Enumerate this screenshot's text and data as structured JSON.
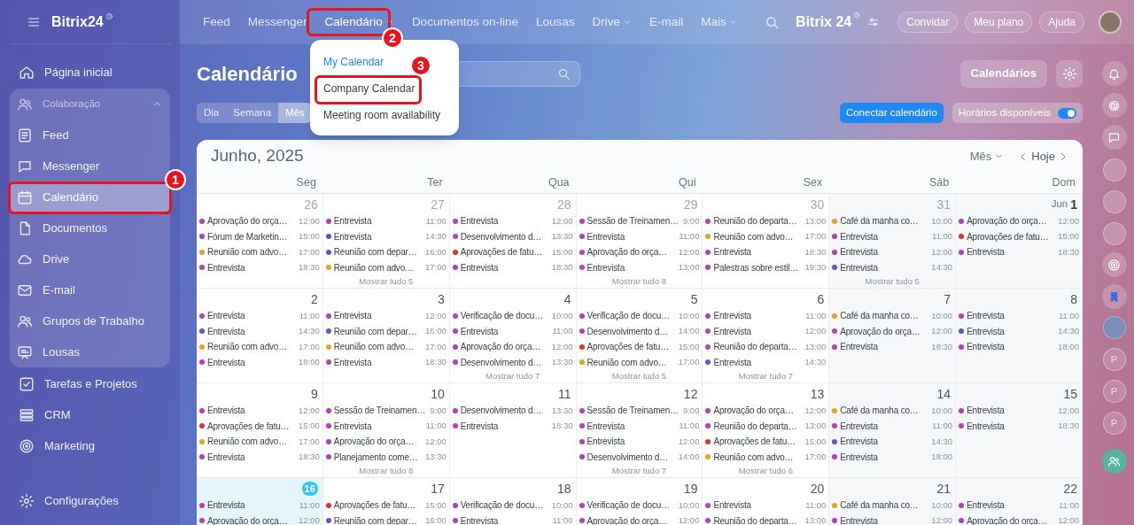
{
  "sidebar": {
    "logo": "Bitrix24",
    "items": [
      {
        "kind": "link",
        "label": "Página inicial",
        "selected": false
      },
      {
        "kind": "group",
        "label": "Colaboração",
        "expanded": true,
        "children": [
          {
            "label": "Feed",
            "selected": false
          },
          {
            "label": "Messenger",
            "selected": false
          },
          {
            "label": "Calendário",
            "selected": true
          },
          {
            "label": "Documentos",
            "selected": false
          },
          {
            "label": "Drive",
            "selected": false
          },
          {
            "label": "E-mail",
            "selected": false
          },
          {
            "label": "Grupos de Trabalho",
            "selected": false
          },
          {
            "label": "Lousas",
            "selected": false
          }
        ]
      },
      {
        "kind": "link",
        "label": "Tarefas e Projetos",
        "selected": false
      },
      {
        "kind": "link",
        "label": "CRM",
        "selected": false
      },
      {
        "kind": "link",
        "label": "Marketing",
        "selected": false
      }
    ],
    "footer": "Configurações"
  },
  "top_nav": {
    "items": [
      {
        "label": "Feed",
        "dropdown": false,
        "selected": false
      },
      {
        "label": "Messenger",
        "dropdown": false,
        "selected": false
      },
      {
        "label": "Calendário",
        "dropdown": true,
        "selected": true
      },
      {
        "label": "Documentos on-line",
        "dropdown": false,
        "selected": false
      },
      {
        "label": "Lousas",
        "dropdown": false,
        "selected": false
      },
      {
        "label": "Drive",
        "dropdown": true,
        "selected": false
      },
      {
        "label": "E-mail",
        "dropdown": false,
        "selected": false
      },
      {
        "label": "Mais",
        "dropdown": true,
        "selected": false
      }
    ],
    "logo": "Bitrix 24",
    "buttons": [
      "Convidar",
      "Meu plano",
      "Ajuda"
    ]
  },
  "dropdown_menu": {
    "items": [
      {
        "label": "My Calendar",
        "selected": true
      },
      {
        "label": "Company Calendar",
        "selected": false
      },
      {
        "label": "Meeting room availability",
        "selected": false
      }
    ]
  },
  "page": {
    "title": "Calendário",
    "view_tabs": [
      {
        "label": "Dia",
        "selected": false
      },
      {
        "label": "Semana",
        "selected": false
      },
      {
        "label": "Mês",
        "selected": true
      }
    ],
    "calendars_button": "Calendários",
    "connect_button": "Conectar calendário",
    "availability": {
      "label": "Horários disponíveis",
      "on": true
    }
  },
  "calendar": {
    "title": "Junho, 2025",
    "view_select": "Mês",
    "today_button": "Hoje",
    "weekdays": [
      "Seg",
      "Ter",
      "Qua",
      "Qui",
      "Sex",
      "Sáb",
      "Dom"
    ],
    "weeks": [
      {
        "days": [
          {
            "date": "26",
            "other_month": true,
            "today": false,
            "events": [
              {
                "title": "Aprovação do orça…",
                "time": "12:00",
                "color": "#b83cc0"
              },
              {
                "title": "Fórum de Marketin…",
                "time": "15:00",
                "color": "#b83cc0"
              },
              {
                "title": "Reunião com advo…",
                "time": "17:00",
                "color": "#eaa11b"
              },
              {
                "title": "Entrevista",
                "time": "18:30",
                "color": "#b83cc0"
              }
            ]
          },
          {
            "date": "27",
            "other_month": true,
            "today": false,
            "events": [
              {
                "title": "Entrevista",
                "time": "11:00",
                "color": "#b83cc0"
              },
              {
                "title": "Entrevista",
                "time": "14:30",
                "color": "#6a4fd6"
              },
              {
                "title": "Reunião com depar…",
                "time": "16:00",
                "color": "#6a4fd6"
              },
              {
                "title": "Reunião com advo…",
                "time": "17:00",
                "color": "#eaa11b"
              }
            ],
            "more": "Mostrar tudo 5"
          },
          {
            "date": "28",
            "other_month": true,
            "today": false,
            "events": [
              {
                "title": "Entrevista",
                "time": "12:00",
                "color": "#b83cc0"
              },
              {
                "title": "Desenvolvimento d…",
                "time": "13:30",
                "color": "#b83cc0"
              },
              {
                "title": "Aprovações de fatu…",
                "time": "15:00",
                "color": "#e0322e"
              },
              {
                "title": "Entrevista",
                "time": "18:30",
                "color": "#b83cc0"
              }
            ]
          },
          {
            "date": "29",
            "other_month": true,
            "today": false,
            "events": [
              {
                "title": "Sessão de Treinamen…",
                "time": "9:00",
                "color": "#b83cc0"
              },
              {
                "title": "Entrevista",
                "time": "11:00",
                "color": "#b83cc0"
              },
              {
                "title": "Aprovação do orça…",
                "time": "12:00",
                "color": "#b83cc0"
              },
              {
                "title": "Entrevista",
                "time": "13:00",
                "color": "#b83cc0"
              }
            ],
            "more": "Mostrar tudo 8"
          },
          {
            "date": "30",
            "other_month": true,
            "today": false,
            "events": [
              {
                "title": "Reunião do departa…",
                "time": "13:00",
                "color": "#b83cc0"
              },
              {
                "title": "Reunião com advo…",
                "time": "17:00",
                "color": "#eaa11b"
              },
              {
                "title": "Entrevista",
                "time": "18:30",
                "color": "#b83cc0"
              },
              {
                "title": "Palestras sobre estil…",
                "time": "19:30",
                "color": "#b83cc0"
              }
            ]
          },
          {
            "date": "31",
            "other_month": true,
            "today": false,
            "events": [
              {
                "title": "Café da manha co…",
                "time": "10:00",
                "color": "#eaa11b"
              },
              {
                "title": "Entrevista",
                "time": "11:00",
                "color": "#b83cc0"
              },
              {
                "title": "Entrevista",
                "time": "12:00",
                "color": "#b83cc0"
              },
              {
                "title": "Entrevista",
                "time": "14:30",
                "color": "#6a4fd6"
              }
            ],
            "more": "Mostrar tudo 5"
          },
          {
            "date": "1",
            "month_label": "Jun",
            "other_month": false,
            "today": false,
            "events": [
              {
                "title": "Aprovação do orça…",
                "time": "12:00",
                "color": "#b83cc0"
              },
              {
                "title": "Aprovações de fatu…",
                "time": "15:00",
                "color": "#e0322e"
              },
              {
                "title": "Entrevista",
                "time": "18:30",
                "color": "#b83cc0"
              }
            ]
          }
        ]
      },
      {
        "days": [
          {
            "date": "2",
            "other_month": false,
            "today": false,
            "events": [
              {
                "title": "Entrevista",
                "time": "11:00",
                "color": "#b83cc0"
              },
              {
                "title": "Entrevista",
                "time": "14:30",
                "color": "#6a4fd6"
              },
              {
                "title": "Reunião com advo…",
                "time": "17:00",
                "color": "#eaa11b"
              },
              {
                "title": "Entrevista",
                "time": "18:00",
                "color": "#b83cc0"
              }
            ]
          },
          {
            "date": "3",
            "other_month": false,
            "today": false,
            "events": [
              {
                "title": "Entrevista",
                "time": "12:00",
                "color": "#b83cc0"
              },
              {
                "title": "Reunião com depar…",
                "time": "16:00",
                "color": "#6a4fd6"
              },
              {
                "title": "Reunião com advo…",
                "time": "17:00",
                "color": "#eaa11b"
              },
              {
                "title": "Entrevista",
                "time": "18:30",
                "color": "#b83cc0"
              }
            ]
          },
          {
            "date": "4",
            "other_month": false,
            "today": false,
            "events": [
              {
                "title": "Verificação de docu…",
                "time": "10:00",
                "color": "#b83cc0"
              },
              {
                "title": "Entrevista",
                "time": "11:00",
                "color": "#b83cc0"
              },
              {
                "title": "Aprovação do orça…",
                "time": "12:00",
                "color": "#b83cc0"
              },
              {
                "title": "Desenvolvimento d…",
                "time": "13:30",
                "color": "#b83cc0"
              }
            ],
            "more": "Mostrar tudo 7"
          },
          {
            "date": "5",
            "other_month": false,
            "today": false,
            "events": [
              {
                "title": "Verificação de docu…",
                "time": "10:00",
                "color": "#b83cc0"
              },
              {
                "title": "Desenvolvimento d…",
                "time": "14:00",
                "color": "#b83cc0"
              },
              {
                "title": "Aprovações de fatu…",
                "time": "15:00",
                "color": "#e0322e"
              },
              {
                "title": "Reunião com advo…",
                "time": "17:00",
                "color": "#eaa11b"
              }
            ],
            "more": "Mostrar tudo 5"
          },
          {
            "date": "6",
            "other_month": false,
            "today": false,
            "events": [
              {
                "title": "Entrevista",
                "time": "11:00",
                "color": "#b83cc0"
              },
              {
                "title": "Entrevista",
                "time": "12:00",
                "color": "#b83cc0"
              },
              {
                "title": "Reunião do departa…",
                "time": "13:00",
                "color": "#b83cc0"
              },
              {
                "title": "Entrevista",
                "time": "14:30",
                "color": "#6a4fd6"
              }
            ],
            "more": "Mostrar tudo 7"
          },
          {
            "date": "7",
            "other_month": false,
            "today": false,
            "events": [
              {
                "title": "Café da manha co…",
                "time": "10:00",
                "color": "#eaa11b"
              },
              {
                "title": "Aprovação do orça…",
                "time": "12:00",
                "color": "#b83cc0"
              },
              {
                "title": "Entrevista",
                "time": "18:30",
                "color": "#b83cc0"
              }
            ]
          },
          {
            "date": "8",
            "other_month": false,
            "today": false,
            "events": [
              {
                "title": "Entrevista",
                "time": "11:00",
                "color": "#b83cc0"
              },
              {
                "title": "Entrevista",
                "time": "14:30",
                "color": "#6a4fd6"
              },
              {
                "title": "Entrevista",
                "time": "18:00",
                "color": "#b83cc0"
              }
            ]
          }
        ]
      },
      {
        "days": [
          {
            "date": "9",
            "other_month": false,
            "today": false,
            "events": [
              {
                "title": "Entrevista",
                "time": "12:00",
                "color": "#b83cc0"
              },
              {
                "title": "Aprovações de fatu…",
                "time": "15:00",
                "color": "#e0322e"
              },
              {
                "title": "Reunião com advo…",
                "time": "17:00",
                "color": "#eaa11b"
              },
              {
                "title": "Entrevista",
                "time": "18:30",
                "color": "#b83cc0"
              }
            ]
          },
          {
            "date": "10",
            "other_month": false,
            "today": false,
            "events": [
              {
                "title": "Sessão de Treinamen…",
                "time": "9:00",
                "color": "#b83cc0"
              },
              {
                "title": "Entrevista",
                "time": "11:00",
                "color": "#b83cc0"
              },
              {
                "title": "Aprovação do orça…",
                "time": "12:00",
                "color": "#b83cc0"
              },
              {
                "title": "Planejamento come…",
                "time": "13:30",
                "color": "#b83cc0"
              }
            ],
            "more": "Mostrar tudo 8"
          },
          {
            "date": "11",
            "other_month": false,
            "today": false,
            "events": [
              {
                "title": "Desenvolvimento d…",
                "time": "13:30",
                "color": "#b83cc0"
              },
              {
                "title": "Entrevista",
                "time": "18:30",
                "color": "#b83cc0"
              }
            ]
          },
          {
            "date": "12",
            "other_month": false,
            "today": false,
            "events": [
              {
                "title": "Sessão de Treinamen…",
                "time": "9:00",
                "color": "#b83cc0"
              },
              {
                "title": "Entrevista",
                "time": "11:00",
                "color": "#b83cc0"
              },
              {
                "title": "Entrevista",
                "time": "12:00",
                "color": "#b83cc0"
              },
              {
                "title": "Desenvolvimento d…",
                "time": "14:00",
                "color": "#b83cc0"
              }
            ],
            "more": "Mostrar tudo 7"
          },
          {
            "date": "13",
            "other_month": false,
            "today": false,
            "events": [
              {
                "title": "Aprovação do orça…",
                "time": "12:00",
                "color": "#b83cc0"
              },
              {
                "title": "Reunião do departa…",
                "time": "13:00",
                "color": "#b83cc0"
              },
              {
                "title": "Aprovações de fatu…",
                "time": "15:00",
                "color": "#e0322e"
              },
              {
                "title": "Reunião com advo…",
                "time": "17:00",
                "color": "#eaa11b"
              }
            ],
            "more": "Mostrar tudo 6"
          },
          {
            "date": "14",
            "other_month": false,
            "today": false,
            "events": [
              {
                "title": "Café da manha co…",
                "time": "10:00",
                "color": "#eaa11b"
              },
              {
                "title": "Entrevista",
                "time": "11:00",
                "color": "#b83cc0"
              },
              {
                "title": "Entrevista",
                "time": "14:30",
                "color": "#6a4fd6"
              },
              {
                "title": "Entrevista",
                "time": "18:00",
                "color": "#b83cc0"
              }
            ]
          },
          {
            "date": "15",
            "other_month": false,
            "today": false,
            "events": [
              {
                "title": "Entrevista",
                "time": "12:00",
                "color": "#b83cc0"
              },
              {
                "title": "Entrevista",
                "time": "18:30",
                "color": "#b83cc0"
              }
            ]
          }
        ]
      },
      {
        "days": [
          {
            "date": "16",
            "other_month": false,
            "today": true,
            "events": [
              {
                "title": "Entrevista",
                "time": "11:00",
                "color": "#b83cc0"
              },
              {
                "title": "Aprovação do orça…",
                "time": "12:00",
                "color": "#b83cc0"
              }
            ]
          },
          {
            "date": "17",
            "other_month": false,
            "today": false,
            "events": [
              {
                "title": "Aprovações de fatu…",
                "time": "15:00",
                "color": "#e0322e"
              },
              {
                "title": "Reunião com depar…",
                "time": "16:00",
                "color": "#6a4fd6"
              }
            ]
          },
          {
            "date": "18",
            "other_month": false,
            "today": false,
            "events": [
              {
                "title": "Verificação de docu…",
                "time": "10:00",
                "color": "#b83cc0"
              },
              {
                "title": "Entrevista",
                "time": "11:00",
                "color": "#b83cc0"
              }
            ]
          },
          {
            "date": "19",
            "other_month": false,
            "today": false,
            "events": [
              {
                "title": "Verificação de docu…",
                "time": "10:00",
                "color": "#b83cc0"
              },
              {
                "title": "Aprovação do orça…",
                "time": "12:00",
                "color": "#b83cc0"
              }
            ]
          },
          {
            "date": "20",
            "other_month": false,
            "today": false,
            "events": [
              {
                "title": "Entrevista",
                "time": "11:00",
                "color": "#b83cc0"
              },
              {
                "title": "Reunião do departa…",
                "time": "13:00",
                "color": "#b83cc0"
              }
            ]
          },
          {
            "date": "21",
            "other_month": false,
            "today": false,
            "events": [
              {
                "title": "Café da manha co…",
                "time": "10:00",
                "color": "#eaa11b"
              },
              {
                "title": "Entrevista",
                "time": "12:00",
                "color": "#b83cc0"
              }
            ]
          },
          {
            "date": "22",
            "other_month": false,
            "today": false,
            "events": [
              {
                "title": "Entrevista",
                "time": "11:00",
                "color": "#b83cc0"
              },
              {
                "title": "Aprovação do orça…",
                "time": "12:00",
                "color": "#b83cc0"
              }
            ]
          }
        ]
      }
    ]
  },
  "right_rail": {
    "avatars": [
      "P",
      "P",
      "P"
    ]
  },
  "annotations": [
    {
      "number": "1"
    },
    {
      "number": "2"
    },
    {
      "number": "3"
    }
  ]
}
